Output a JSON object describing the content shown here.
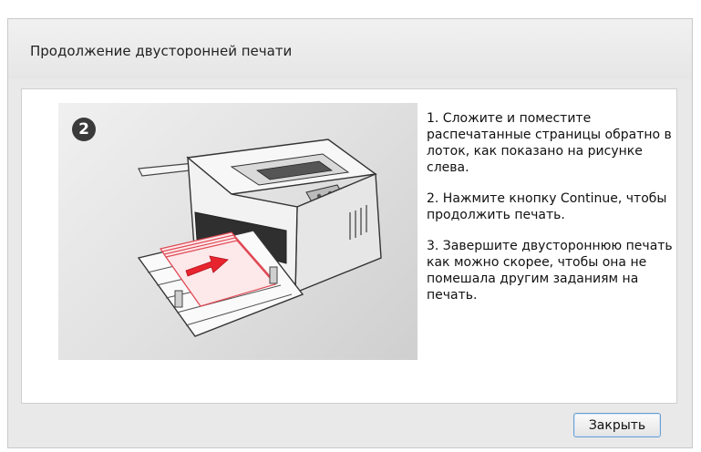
{
  "dialog": {
    "title": "Продолжение двусторонней печати",
    "step_number": "2",
    "instructions": [
      "1. Сложите и поместите распечатанные страницы обратно в лоток, как показано на рисунке слева.",
      "2. Нажмите кнопку Continue, чтобы продолжить печать.",
      "3. Завершите двустороннюю печать как можно скорее, чтобы она не помешала другим заданиям на печать."
    ],
    "close_label": "Закрыть"
  },
  "colors": {
    "paper_stroke": "#e04a55",
    "arrow_fill": "#e8242e"
  },
  "icons": {
    "step_badge": "number-2-circle-icon",
    "illustration": "printer-illustration"
  }
}
